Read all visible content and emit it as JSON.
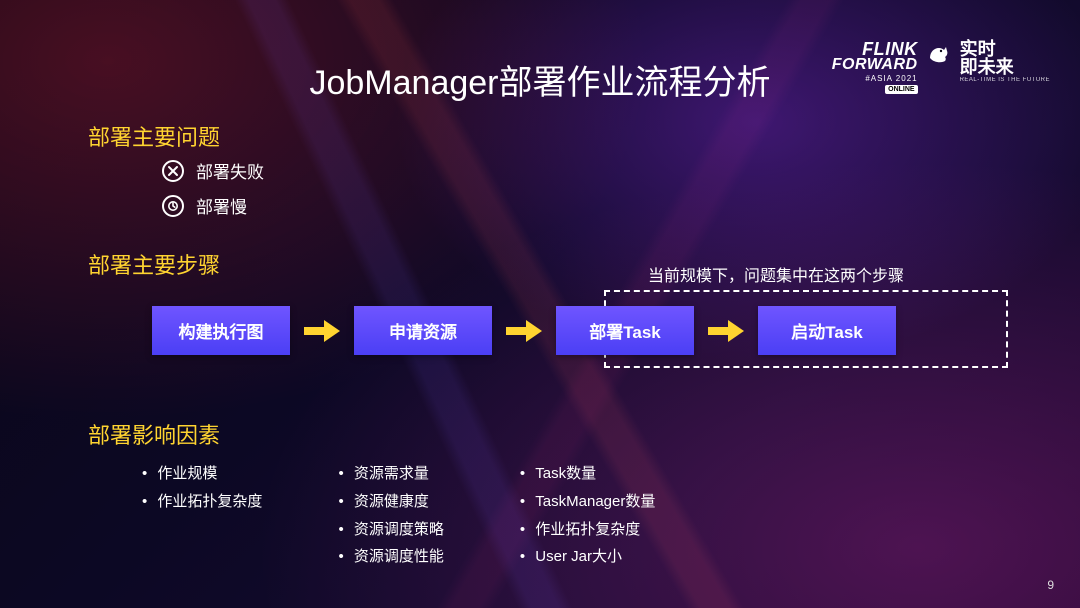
{
  "title": "JobManager部署作业流程分析",
  "logo": {
    "line1": "FLINK",
    "line2": "FORWARD",
    "asia": "#ASIA 2021",
    "online": "ONLINE",
    "cn1": "实时",
    "cn2": "即未来",
    "cn_sub": "REAL-TIME IS THE FUTURE"
  },
  "sections": {
    "issues_h": "部署主要问题",
    "steps_h": "部署主要步骤",
    "factors_h": "部署影响因素"
  },
  "issues": {
    "fail": "部署失败",
    "slow": "部署慢"
  },
  "note": "当前规模下，问题集中在这两个步骤",
  "steps": {
    "s1": "构建执行图",
    "s2": "申请资源",
    "s3": "部署Task",
    "s4": "启动Task"
  },
  "factors": {
    "col1": [
      "作业规模",
      "作业拓扑复杂度"
    ],
    "col2": [
      "资源需求量",
      "资源健康度",
      "资源调度策略",
      "资源调度性能"
    ],
    "col3": [
      "Task数量",
      "TaskManager数量",
      "作业拓扑复杂度",
      "User Jar大小"
    ]
  },
  "page": "9",
  "icons": {
    "cross": "cross-icon",
    "clock": "clock-icon",
    "arrow": "arrow-right-icon",
    "squirrel": "flink-squirrel-icon"
  }
}
